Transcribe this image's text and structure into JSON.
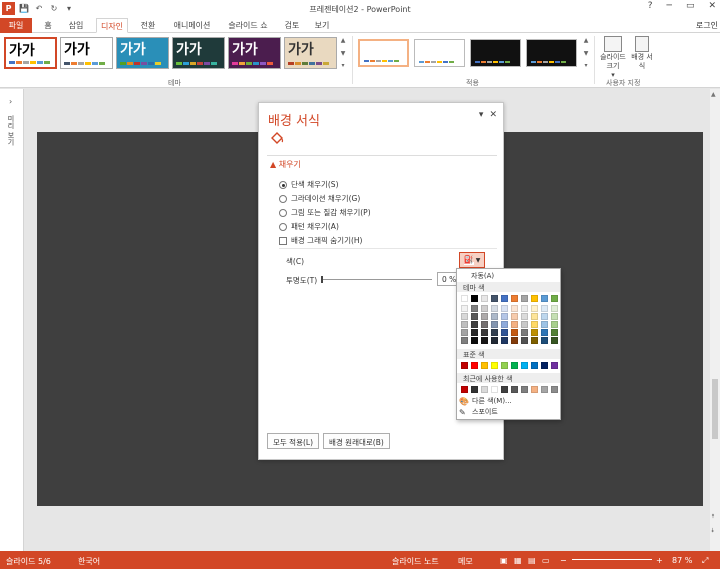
{
  "window": {
    "title": "프레젠테이션2 - PowerPoint",
    "login": "로그인",
    "app_icon": "P",
    "minimize": "─",
    "restore": "▭",
    "close": "✕",
    "help": "?"
  },
  "quick_access": {
    "save_icon": "💾",
    "undo_icon": "↶",
    "redo_icon": "↻",
    "extra_icon": "▾"
  },
  "tabs": [
    {
      "label": "파일"
    },
    {
      "label": "홈"
    },
    {
      "label": "삽입"
    },
    {
      "label": "디자인"
    },
    {
      "label": "전환"
    },
    {
      "label": "애니메이션"
    },
    {
      "label": "슬라이드 쇼"
    },
    {
      "label": "검토"
    },
    {
      "label": "보기"
    }
  ],
  "active_tab": "디자인",
  "ribbon": {
    "themes_label": "테마",
    "variants_label": "적용",
    "customize_label": "사용자 지정",
    "theme_sample": "가가",
    "slide_size_label": "슬라이드 크기",
    "slide_size_arrow": "▾",
    "format_bg_label": "배경 서식",
    "themes": [
      {
        "bg": "#ffffff",
        "fg": "#000000",
        "colors": [
          "#4472c4",
          "#ed7d31",
          "#a5a5a5",
          "#ffc000",
          "#5b9bd5",
          "#70ad47"
        ]
      },
      {
        "bg": "#ffffff",
        "fg": "#000000",
        "colors": [
          "#44546a",
          "#ed7d31",
          "#a5a5a5",
          "#ffc000",
          "#5b9bd5",
          "#70ad47"
        ]
      },
      {
        "bg": "#2a8fb8",
        "fg": "#ffffff",
        "colors": [
          "#54a021",
          "#e68b1b",
          "#c0342b",
          "#7a4da0",
          "#2c6ea8",
          "#e8ce2b"
        ]
      },
      {
        "bg": "#1f3a3a",
        "fg": "#ffffff",
        "colors": [
          "#6ac13c",
          "#2c9fd6",
          "#d9a627",
          "#c4433b",
          "#7d4ba2",
          "#38b39f"
        ]
      },
      {
        "bg": "#4b1d4e",
        "fg": "#ffffff",
        "colors": [
          "#e33a9a",
          "#f2a23a",
          "#6eaf3c",
          "#2a94c9",
          "#8c58c2",
          "#ec5b3c"
        ]
      },
      {
        "bg": "#e9d9c0",
        "fg": "#333333",
        "colors": [
          "#b43e23",
          "#d88d2c",
          "#5e7c3a",
          "#40729d",
          "#7a4c8a",
          "#c9a837"
        ]
      }
    ],
    "variants": [
      {
        "bg": "#ffffff",
        "colors": [
          "#4472c4",
          "#ed7d31",
          "#a5a5a5",
          "#ffc000",
          "#5b9bd5",
          "#70ad47"
        ]
      },
      {
        "bg": "#ffffff",
        "colors": [
          "#5b9bd5",
          "#ed7d31",
          "#a5a5a5",
          "#ffc000",
          "#4472c4",
          "#70ad47"
        ]
      },
      {
        "bg": "#111111",
        "colors": [
          "#4472c4",
          "#ed7d31",
          "#a5a5a5",
          "#ffc000",
          "#5b9bd5",
          "#70ad47"
        ]
      },
      {
        "bg": "#111111",
        "colors": [
          "#5b9bd5",
          "#ed7d31",
          "#a5a5a5",
          "#ffc000",
          "#4472c4",
          "#70ad47"
        ]
      }
    ]
  },
  "left_panel": {
    "label": "미리 보기",
    "chevron": "›"
  },
  "pane": {
    "title": "배경 서식",
    "fill_section": "채우기",
    "fill_options": [
      "단색 채우기(S)",
      "그라데이션 채우기(G)",
      "그림 또는 질감 채우기(P)",
      "패턴 채우기(A)"
    ],
    "hide_graphics": "배경 그래픽 숨기기(H)",
    "color_label": "색(C)",
    "transparency_label": "투명도(T)",
    "transparency_value": "0 %",
    "transparency": 0,
    "apply_all": "모두 적용(L)",
    "reset": "배경 원래대로(B)",
    "dropdown": "▾",
    "close": "✕"
  },
  "palette": {
    "automatic": "자동(A)",
    "theme_colors": "테마 색",
    "standard_colors": "표준 색",
    "recent_colors": "최근에 사용한 색",
    "more_colors": "다른 색(M)...",
    "eyedropper": "스포이트",
    "theme_top": [
      "#ffffff",
      "#000000",
      "#e7e6e6",
      "#44546a",
      "#4472c4",
      "#ed7d31",
      "#a5a5a5",
      "#ffc000",
      "#5b9bd5",
      "#70ad47"
    ],
    "theme_shades": [
      [
        "#f2f2f2",
        "#7f7f7f",
        "#d0cece",
        "#d6dce4",
        "#d9e2f3",
        "#fbe5d5",
        "#ededed",
        "#fff2cc",
        "#deebf6",
        "#e2efd9"
      ],
      [
        "#d8d8d8",
        "#595959",
        "#aeaaaa",
        "#adb9ca",
        "#b4c6e7",
        "#f7cbac",
        "#dbdbdb",
        "#fee599",
        "#bdd7ee",
        "#c5e0b3"
      ],
      [
        "#bfbfbf",
        "#3f3f3f",
        "#757070",
        "#8496b0",
        "#8eaadb",
        "#f4b183",
        "#c9c9c9",
        "#ffd965",
        "#9dc3e6",
        "#a8d08d"
      ],
      [
        "#a5a5a5",
        "#262626",
        "#3a3838",
        "#323f4f",
        "#2f5496",
        "#c55a11",
        "#7b7b7b",
        "#bf9000",
        "#2e75b5",
        "#538135"
      ],
      [
        "#7f7f7f",
        "#0c0c0c",
        "#171616",
        "#222a35",
        "#1f3864",
        "#833c0b",
        "#525252",
        "#7f6000",
        "#1e4e79",
        "#375623"
      ]
    ],
    "standard": [
      "#c00000",
      "#ff0000",
      "#ffc000",
      "#ffff00",
      "#92d050",
      "#00b050",
      "#00b0f0",
      "#0070c0",
      "#002060",
      "#7030a0"
    ],
    "recent": [
      "#c00000",
      "#333333",
      "#d9d9d9",
      "#ffffff",
      "#404040",
      "#595959",
      "#7f7f7f",
      "#f4b183",
      "#a5a5a5",
      "#8c8c8c"
    ]
  },
  "status": {
    "slide_info": "슬라이드 5/6",
    "language": "한국어",
    "notes": "슬라이드 노트",
    "comments": "메모",
    "zoom": "87 %"
  }
}
